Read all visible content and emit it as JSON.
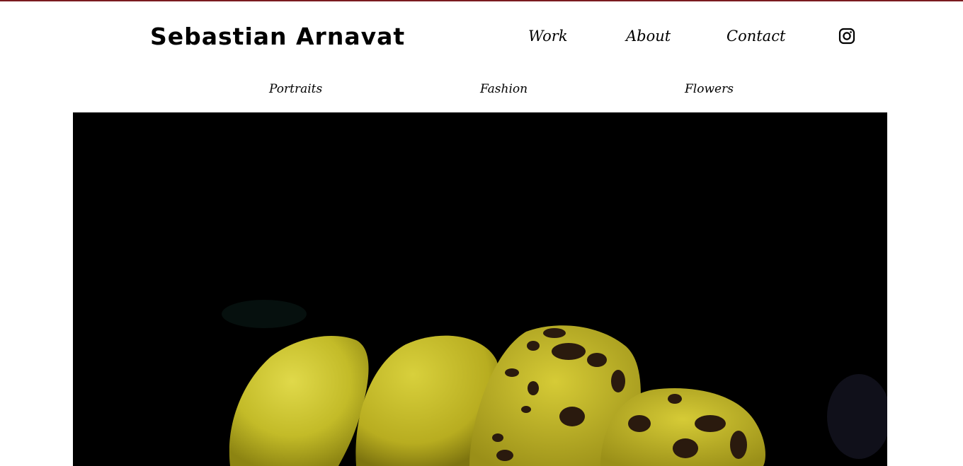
{
  "header": {
    "site_title": "Sebastian Arnavat",
    "accent_color": "#7a1a1f"
  },
  "main_nav": {
    "work": "Work",
    "about": "About",
    "contact": "Contact",
    "social_icon": "instagram-icon"
  },
  "sub_nav": {
    "portraits": "Portraits",
    "fashion": "Fashion",
    "flowers": "Flowers"
  },
  "hero": {
    "subject": "yellow-flower-photo",
    "background_color": "#000000",
    "petal_color": "#c9c22a",
    "spot_color": "#2a1a0e"
  }
}
